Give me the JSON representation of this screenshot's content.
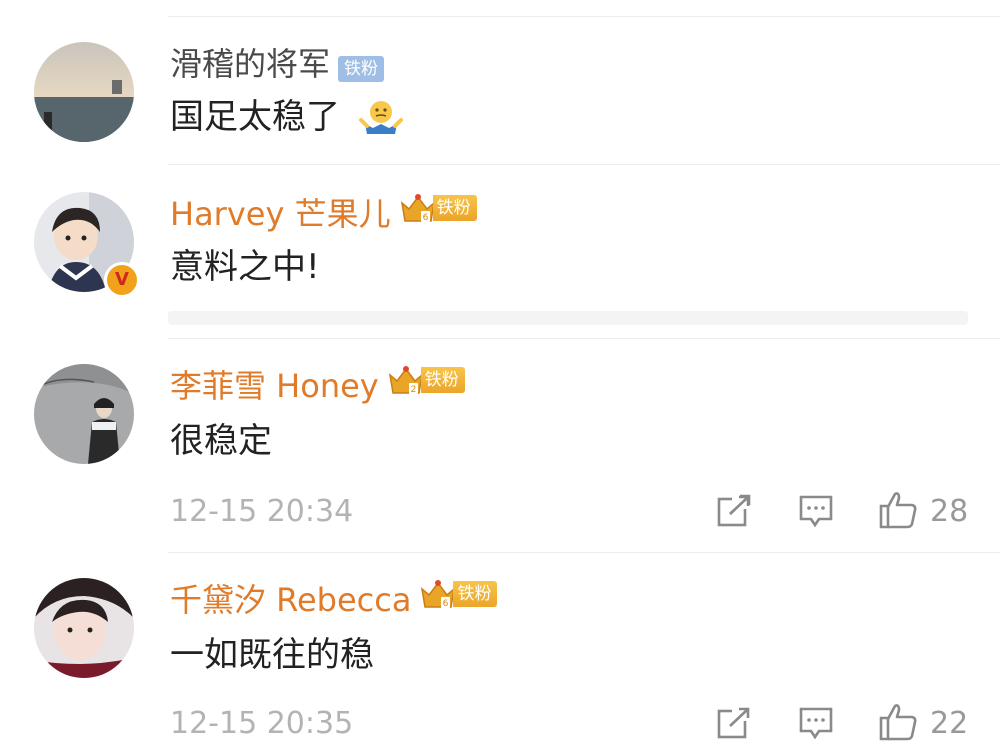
{
  "comments": [
    {
      "name": "滑稽的将军",
      "badge": "铁粉",
      "badge_style": "blue",
      "text": "国足太稳了",
      "emoji": "shrug-emoji"
    },
    {
      "name": "Harvey 芒果儿",
      "badge": "铁粉",
      "badge_style": "gold",
      "text": "意料之中!",
      "verified": "V"
    },
    {
      "name": "李菲雪 Honey",
      "badge": "铁粉",
      "badge_style": "gold",
      "text": "很稳定",
      "time": "12-15 20:34",
      "likes": "28"
    },
    {
      "name": "千黛汐 Rebecca",
      "badge": "铁粉",
      "badge_style": "gold",
      "text": "一如既往的稳",
      "time": "12-15 20:35",
      "likes": "22"
    }
  ],
  "colors": {
    "name_orange": "#e07b2a",
    "badge_blue": "#9fbee6",
    "badge_gold": "#f0b234",
    "meta_gray": "#b3b3b3"
  }
}
